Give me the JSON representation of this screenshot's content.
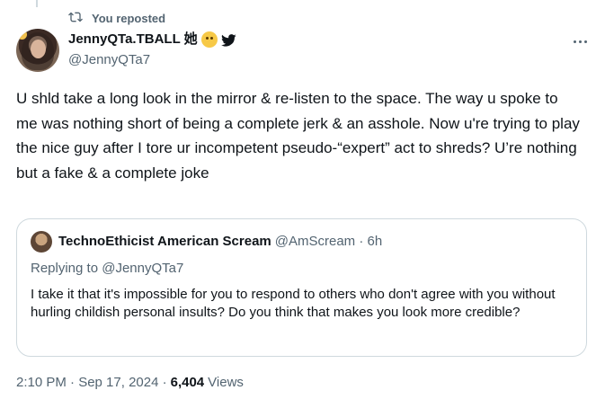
{
  "repost": {
    "label": "You reposted",
    "icon": "repost-icon"
  },
  "author": {
    "display_name": "JennyQTa.TBALL 她",
    "handle": "@JennyQTa7",
    "emoji": "smiling-face-emoji",
    "platform_icon": "bird-icon"
  },
  "more_icon": "more-options-icon",
  "tweet": {
    "text": "U shld take a long look in the mirror & re-listen to the space. The way u spoke to me was nothing short of being a complete jerk & an asshole. Now u're trying to play the nice guy after I tore ur incompetent pseudo-“expert” act to shreds? U’re nothing but a fake & a complete joke"
  },
  "quote": {
    "name": "TechnoEthicist American Scream",
    "handle_time": "@AmScream · 6h",
    "replying_to": "Replying to @JennyQTa7",
    "text": "I take it that it's impossible for you to respond to others who don't agree with you without hurling childish personal insults?  Do you think that makes you look more credible?"
  },
  "footer": {
    "timestamp": "2:10 PM · Sep 17, 2024 ·",
    "views_count": "6,404",
    "views_label": "Views"
  },
  "colors": {
    "primary_text": "#0f1419",
    "secondary_text": "#536471",
    "border": "#cfd9de"
  }
}
